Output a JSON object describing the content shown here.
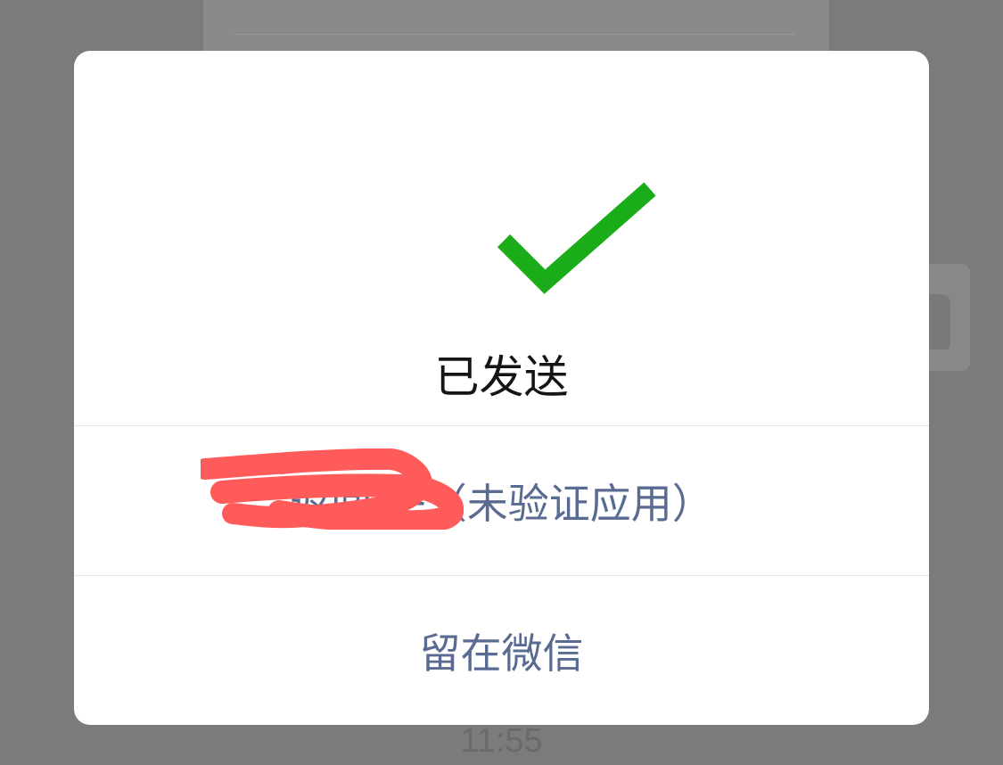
{
  "background": {
    "time": "11:55"
  },
  "dialog": {
    "status_icon": "checkmark-icon",
    "title": "已发送",
    "buttons": {
      "return_app": "返回 子（未验证应用）",
      "stay": "留在微信"
    }
  },
  "colors": {
    "check_green": "#1aad19",
    "button_text": "#5a6b92",
    "redaction": "#ff5b5b"
  }
}
